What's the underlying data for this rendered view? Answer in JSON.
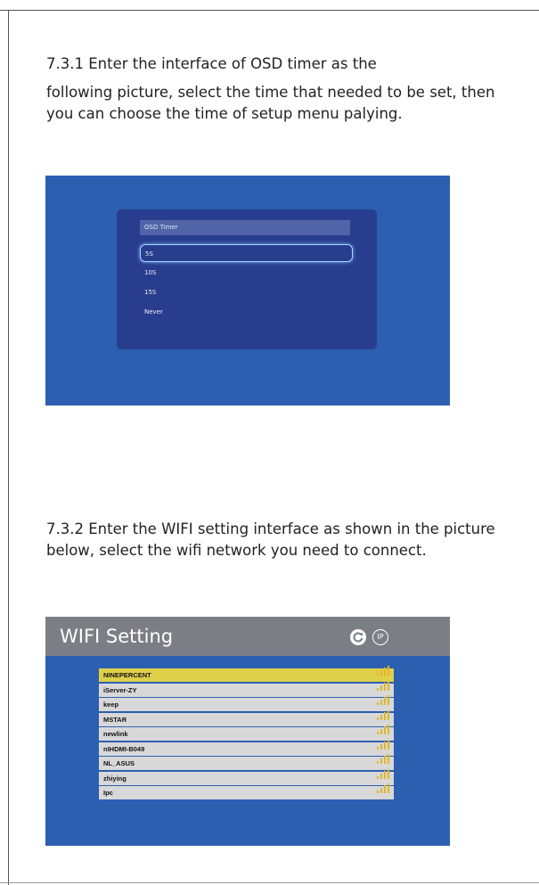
{
  "section1": {
    "line1": "7.3.1 Enter the interface of OSD timer as the",
    "line2": "following picture, select the time that needed to be set, then you can choose the time of setup menu palying."
  },
  "osd": {
    "title": "OSD Timer",
    "options": [
      "5S",
      "10S",
      "15S",
      "Never"
    ],
    "selected_index": 0
  },
  "section2": {
    "text": "7.3.2 Enter the WIFI setting interface as shown in the picture below, select the wifi network you need to connect."
  },
  "wifi": {
    "title": "WIFI Setting",
    "ip_label": "IP",
    "icons": {
      "refresh": "refresh-icon",
      "ip": "ip-icon",
      "signal": "wifi-signal-icon"
    },
    "networks": [
      "NINEPERCENT",
      "iServer-ZY",
      "keep",
      "MSTAR",
      "newlink",
      "nIHDMI-B049",
      "NL_ASUS",
      "zhiying",
      "Ipc"
    ],
    "selected_index": 0,
    "colors": {
      "selected": "#dfd04a",
      "row": "#d8d8d8",
      "background": "#2c5fb0",
      "signal": "#e3b628"
    }
  }
}
